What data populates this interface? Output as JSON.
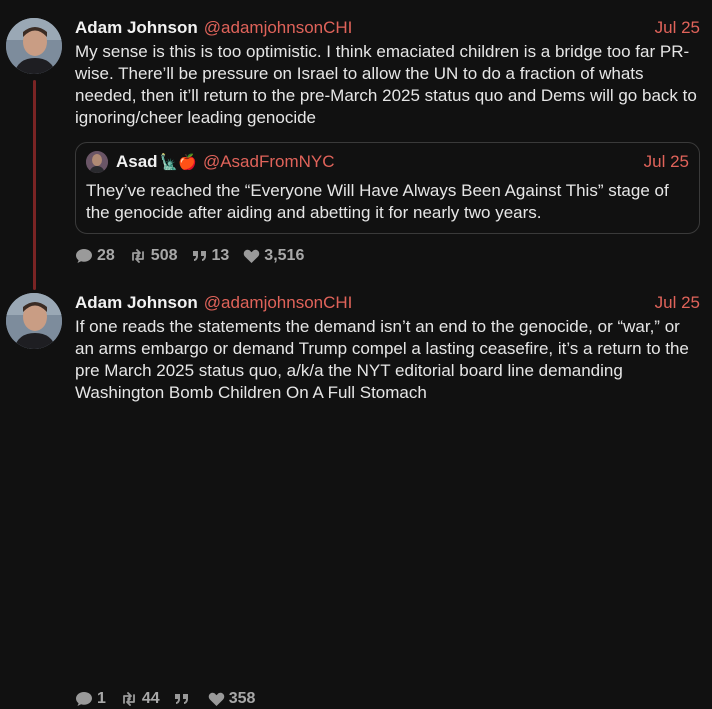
{
  "colors": {
    "background": "#111111",
    "accent": "#e0635a",
    "thread_line": "#7a2424",
    "muted": "#9a9a9a"
  },
  "tweets": [
    {
      "author": "Adam Johnson",
      "handle": "@adamjohnsonCHI",
      "date": "Jul 25",
      "text": "My sense is this is too optimistic. I think emaciated children is a bridge too far PR-wise. There’ll be pressure on Israel to allow the UN to do a fraction of whats needed, then it’ll return to the pre-March 2025 status quo and Dems will go back to ignoring/cheer leading genocide",
      "quote": {
        "author": "Asad",
        "emoji": "🗽🍎",
        "handle": "@AsadFromNYC",
        "date": "Jul 25",
        "text": "They’ve reached the “Everyone Will Have Always Been Against This” stage of the genocide after aiding and abetting it for nearly two years."
      },
      "stats": {
        "replies": "28",
        "reposts": "508",
        "quotes": "13",
        "likes": "3,516"
      }
    },
    {
      "author": "Adam Johnson",
      "handle": "@adamjohnsonCHI",
      "date": "Jul 25",
      "text": "If one reads the statements the demand isn’t an end to the genocide, or “war,” or an arms embargo or demand Trump compel a lasting ceasefire, it’s a return to the pre March 2025 status quo, a/k/a the NYT editorial board line demanding Washington Bomb Children On A Full Stomach",
      "stats": {
        "replies": "1",
        "reposts": "44",
        "quotes": "",
        "likes": "358"
      }
    }
  ],
  "icons": [
    "reply-icon",
    "repost-icon",
    "quote-icon",
    "like-icon"
  ]
}
